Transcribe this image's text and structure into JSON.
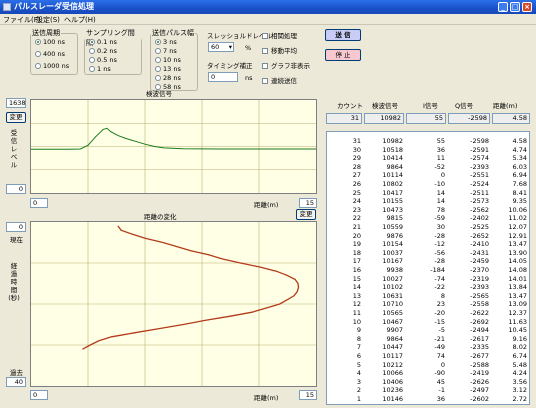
{
  "window": {
    "title": "パルスレーダ受信処理",
    "minimize": "_",
    "maximize": "□",
    "close": "×"
  },
  "menu": [
    "ファイル(F)",
    "設定(S)",
    "ヘルプ(H)"
  ],
  "period": {
    "title": "送信周期",
    "options": [
      "100 ns",
      "400 ns",
      "1000 ns"
    ],
    "selected": 0
  },
  "sampling": {
    "title": "サンプリング間隔",
    "options": [
      "0.1 ns",
      "0.2 ns",
      "0.5 ns",
      "1 ns"
    ],
    "selected": 0
  },
  "pulse": {
    "title": "送信パルス幅",
    "options": [
      "3 ns",
      "7 ns",
      "10 ns",
      "13 ns",
      "28 ns",
      "58 ns"
    ],
    "selected": 0
  },
  "threshold": {
    "label": "スレッショルドレベル",
    "value": "60",
    "unit": "%"
  },
  "timing": {
    "label": "タイミング補正",
    "value": "0",
    "unit": "ns"
  },
  "checks": [
    "相関処理",
    "移動平均",
    "グラフ非表示",
    "連続送信"
  ],
  "buttons": {
    "send": "送 信",
    "stop": "停 止",
    "change1": "変更",
    "change2": "変更"
  },
  "chart1": {
    "title": "検波信号",
    "ymax": "16383",
    "ymin": "0",
    "xmin": "0",
    "xmax": "15",
    "xlabel": "距離(m)",
    "ylabel": "受信レベル"
  },
  "chart2": {
    "title": "距離の変化",
    "top": "0",
    "bottom": "40",
    "label_now": "現在",
    "label_past": "過去",
    "ylabel": "経過時間(秒)",
    "xmin": "0",
    "xmax": "15",
    "xlabel": "距離(m)"
  },
  "table": {
    "headers": [
      "カウント",
      "検波信号",
      "I信号",
      "Q信号",
      "距離(m)"
    ],
    "current": [
      "31",
      "10982",
      "55",
      "-2598",
      "4.58"
    ],
    "rows": [
      [
        "31",
        "10982",
        "55",
        "-2598",
        "4.58"
      ],
      [
        "30",
        "10518",
        "36",
        "-2591",
        "4.74"
      ],
      [
        "29",
        "10414",
        "11",
        "-2574",
        "5.34"
      ],
      [
        "28",
        "9864",
        "-52",
        "-2393",
        "6.03"
      ],
      [
        "27",
        "10114",
        "0",
        "-2551",
        "6.94"
      ],
      [
        "26",
        "10802",
        "-10",
        "-2524",
        "7.68"
      ],
      [
        "25",
        "10417",
        "14",
        "-2511",
        "8.41"
      ],
      [
        "24",
        "10155",
        "14",
        "-2573",
        "9.35"
      ],
      [
        "23",
        "10473",
        "78",
        "-2562",
        "10.06"
      ],
      [
        "22",
        "9815",
        "-59",
        "-2402",
        "11.02"
      ],
      [
        "21",
        "10559",
        "30",
        "-2525",
        "12.07"
      ],
      [
        "20",
        "9876",
        "-28",
        "-2652",
        "12.91"
      ],
      [
        "19",
        "10154",
        "-12",
        "-2410",
        "13.47"
      ],
      [
        "18",
        "10037",
        "-56",
        "-2431",
        "13.90"
      ],
      [
        "17",
        "10167",
        "-28",
        "-2459",
        "14.05"
      ],
      [
        "16",
        "9938",
        "-184",
        "-2370",
        "14.08"
      ],
      [
        "15",
        "10027",
        "-74",
        "-2319",
        "14.01"
      ],
      [
        "14",
        "10102",
        "-22",
        "-2393",
        "13.84"
      ],
      [
        "13",
        "10631",
        "8",
        "-2565",
        "13.47"
      ],
      [
        "12",
        "10710",
        "23",
        "-2558",
        "13.09"
      ],
      [
        "11",
        "10565",
        "-20",
        "-2622",
        "12.37"
      ],
      [
        "10",
        "10467",
        "-15",
        "-2692",
        "11.63"
      ],
      [
        "9",
        "9907",
        "-5",
        "-2494",
        "10.45"
      ],
      [
        "8",
        "9864",
        "-21",
        "-2617",
        "9.16"
      ],
      [
        "7",
        "10447",
        "-49",
        "-2335",
        "8.02"
      ],
      [
        "6",
        "10117",
        "74",
        "-2677",
        "6.74"
      ],
      [
        "5",
        "10212",
        "0",
        "-2588",
        "5.48"
      ],
      [
        "4",
        "10066",
        "-90",
        "-2419",
        "4.24"
      ],
      [
        "3",
        "10406",
        "45",
        "-2626",
        "3.56"
      ],
      [
        "2",
        "10236",
        "-1",
        "-2497",
        "3.12"
      ],
      [
        "1",
        "10146",
        "36",
        "-2602",
        "2.72"
      ]
    ]
  },
  "chart_data": [
    {
      "type": "line",
      "title": "検波信号",
      "xlabel": "距離(m)",
      "ylabel": "受信レベル",
      "xlim": [
        0,
        15
      ],
      "ylim": [
        0,
        16383
      ],
      "x": [
        0,
        2.0,
        2.6,
        3.0,
        3.4,
        3.8,
        4.0,
        4.2,
        4.6,
        5.0,
        5.5,
        6.0,
        6.5,
        7.0,
        8,
        10,
        12,
        15
      ],
      "y": [
        7700,
        7700,
        7750,
        8400,
        9900,
        11200,
        11400,
        10800,
        10100,
        9600,
        9100,
        8600,
        8200,
        7950,
        7800,
        7750,
        7750,
        7750
      ]
    },
    {
      "type": "line",
      "title": "距離の変化",
      "xlabel": "距離(m)",
      "ylabel": "経過時間(秒)",
      "xlim": [
        0,
        15
      ],
      "ylim": [
        0,
        40
      ],
      "x": [
        4.58,
        4.74,
        5.34,
        6.03,
        6.94,
        7.68,
        8.41,
        9.35,
        10.06,
        11.02,
        12.07,
        12.91,
        13.47,
        13.9,
        14.05,
        14.08,
        14.01,
        13.84,
        13.47,
        13.09,
        12.37,
        11.63,
        10.45,
        9.16,
        8.02,
        6.74,
        5.48,
        4.24,
        3.56,
        3.12,
        2.72
      ],
      "y": [
        1,
        2,
        3,
        4,
        5,
        6,
        7,
        8,
        9,
        10,
        11,
        12,
        13,
        14,
        15,
        16,
        17,
        18,
        19,
        20,
        21,
        22,
        23,
        24,
        25,
        26,
        27,
        28,
        29,
        30,
        31
      ]
    }
  ]
}
